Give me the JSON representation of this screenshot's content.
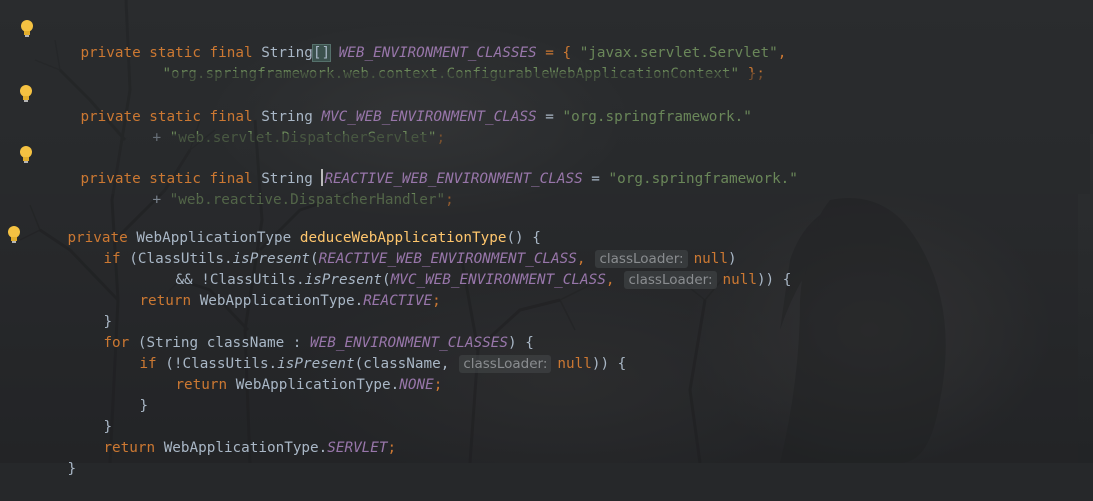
{
  "editor": {
    "language": "java",
    "theme_colors": {
      "keyword": "#cc7832",
      "constant": "#9876aa",
      "string": "#6a8759",
      "method": "#ffc66d",
      "text": "#a9b7c6",
      "hint": "#8a8d90"
    },
    "fields": [
      {
        "line1": {
          "mods": "private static final",
          "type": "String",
          "array": "[]",
          "name": "WEB_ENVIRONMENT_CLASSES",
          "eq": " = { ",
          "value": "\"javax.servlet.Servlet\"",
          "comma": ","
        },
        "line2": {
          "value": "\"org.springframework.web.context.ConfigurableWebApplicationContext\"",
          "end": " };"
        }
      },
      {
        "line1": {
          "mods": "private static final",
          "type": "String",
          "name": "MVC_WEB_ENVIRONMENT_CLASS",
          "eq": " = ",
          "value": "\"org.springframework.\""
        },
        "line2": {
          "plus": "+ ",
          "value": "\"web.servlet.DispatcherServlet\"",
          "end": ";"
        }
      },
      {
        "line1": {
          "mods": "private static final",
          "type": "String",
          "name": "REACTIVE_WEB_ENVIRONMENT_CLASS",
          "eq": " = ",
          "value": "\"org.springframework.\""
        },
        "line2": {
          "plus": "+ ",
          "value": "\"web.reactive.DispatcherHandler\"",
          "end": ";"
        }
      }
    ],
    "method": {
      "kw_private": "private",
      "return_type": "WebApplicationType",
      "name": "deduceWebApplicationType",
      "sig_end": "() {",
      "if1": {
        "kw": "if",
        "open": " (ClassUtils.",
        "call": "isPresent",
        "paren": "(",
        "arg": "REACTIVE_WEB_ENVIRONMENT_CLASS",
        "comma": ",",
        "hint": "classLoader:",
        "null": "null",
        "close": ")"
      },
      "if1b": {
        "pre": "&& !ClassUtils.",
        "call": "isPresent",
        "paren": "(",
        "arg": "MVC_WEB_ENVIRONMENT_CLASS",
        "comma": ",",
        "hint": "classLoader:",
        "null": "null",
        "close": ")) {"
      },
      "ret1": {
        "kw": "return",
        "type": " WebApplicationType.",
        "val": "REACTIVE",
        "end": ";"
      },
      "close1": "}",
      "for": {
        "kw": "for",
        "open": " (String className : ",
        "arg": "WEB_ENVIRONMENT_CLASSES",
        "close": ") {"
      },
      "if2": {
        "kw": "if",
        "open": " (!ClassUtils.",
        "call": "isPresent",
        "paren": "(className,",
        "hint": "classLoader:",
        "null": "null",
        "close": ")) {"
      },
      "ret2": {
        "kw": "return",
        "type": " WebApplicationType.",
        "val": "NONE",
        "end": ";"
      },
      "close2": "}",
      "close3": "}",
      "ret3": {
        "kw": "return",
        "type": " WebApplicationType.",
        "val": "SERVLET",
        "end": ";"
      },
      "close4": "}"
    }
  }
}
